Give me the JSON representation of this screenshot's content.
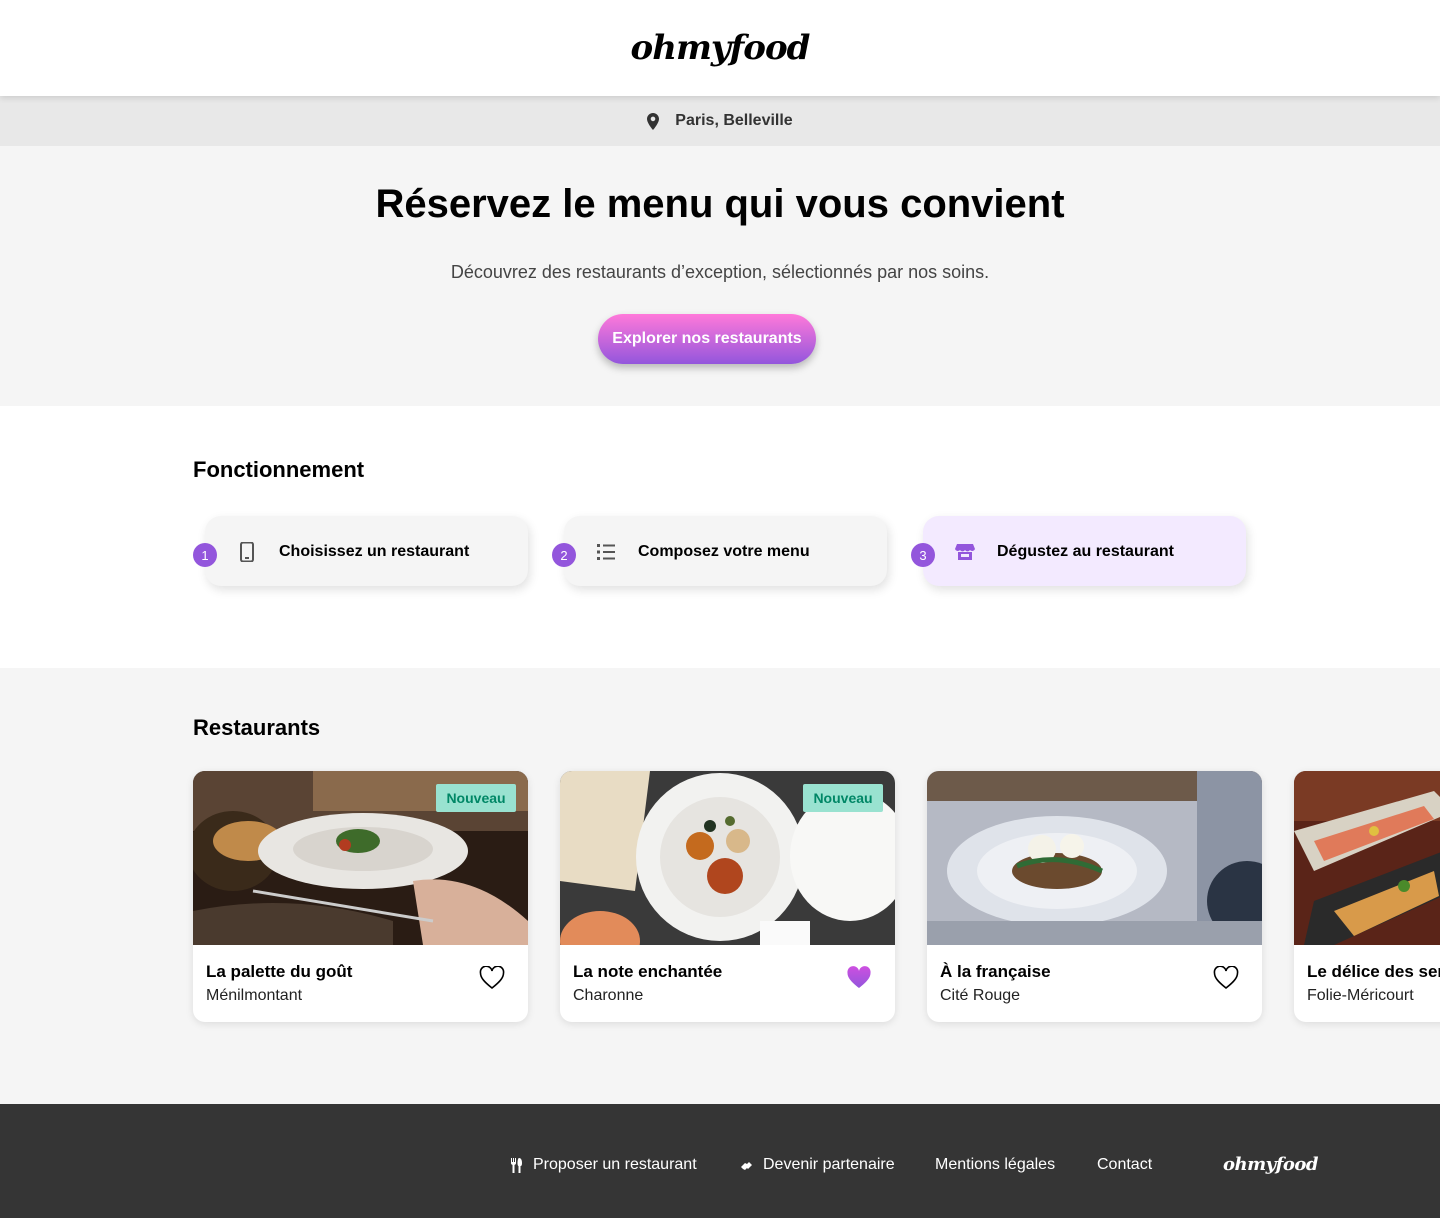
{
  "header": {
    "logo": "ohmyfood"
  },
  "location": {
    "icon": "map-pin-icon",
    "text": "Paris, Belleville"
  },
  "hero": {
    "title": "Réservez le menu qui vous convient",
    "subtitle": "Découvrez des restaurants d’exception, sélectionnés par nos soins.",
    "cta_label": "Explorer nos restaurants"
  },
  "how": {
    "title": "Fonctionnement",
    "steps": [
      {
        "number": "1",
        "icon": "mobile-phone-icon",
        "label": "Choisissez un restaurant"
      },
      {
        "number": "2",
        "icon": "list-icon",
        "label": "Composez votre menu"
      },
      {
        "number": "3",
        "icon": "store-icon",
        "label": "Dégustez au restaurant"
      }
    ]
  },
  "restaurants": {
    "title": "Restaurants",
    "cards": [
      {
        "name": "La palette du goût",
        "area": "Ménilmontant",
        "badge": "Nouveau",
        "liked": false
      },
      {
        "name": "La note enchantée",
        "area": "Charonne",
        "badge": "Nouveau",
        "liked": true
      },
      {
        "name": "À la française",
        "area": "Cité Rouge",
        "badge": "",
        "liked": false
      },
      {
        "name": "Le délice des sens",
        "area": "Folie-Méricourt",
        "badge": "",
        "liked": false
      }
    ]
  },
  "footer": {
    "links": [
      {
        "icon": "utensils-icon",
        "label": "Proposer un restaurant"
      },
      {
        "icon": "handshake-icon",
        "label": "Devenir partenaire"
      },
      {
        "icon": "",
        "label": "Mentions légales"
      },
      {
        "icon": "",
        "label": "Contact"
      }
    ],
    "logo": "ohmyfood"
  },
  "colors": {
    "primary": "#9356dc",
    "secondary": "#ff79da",
    "tertiary": "#99e2d0",
    "badge_text": "#008766",
    "footer_bg": "#353535"
  }
}
